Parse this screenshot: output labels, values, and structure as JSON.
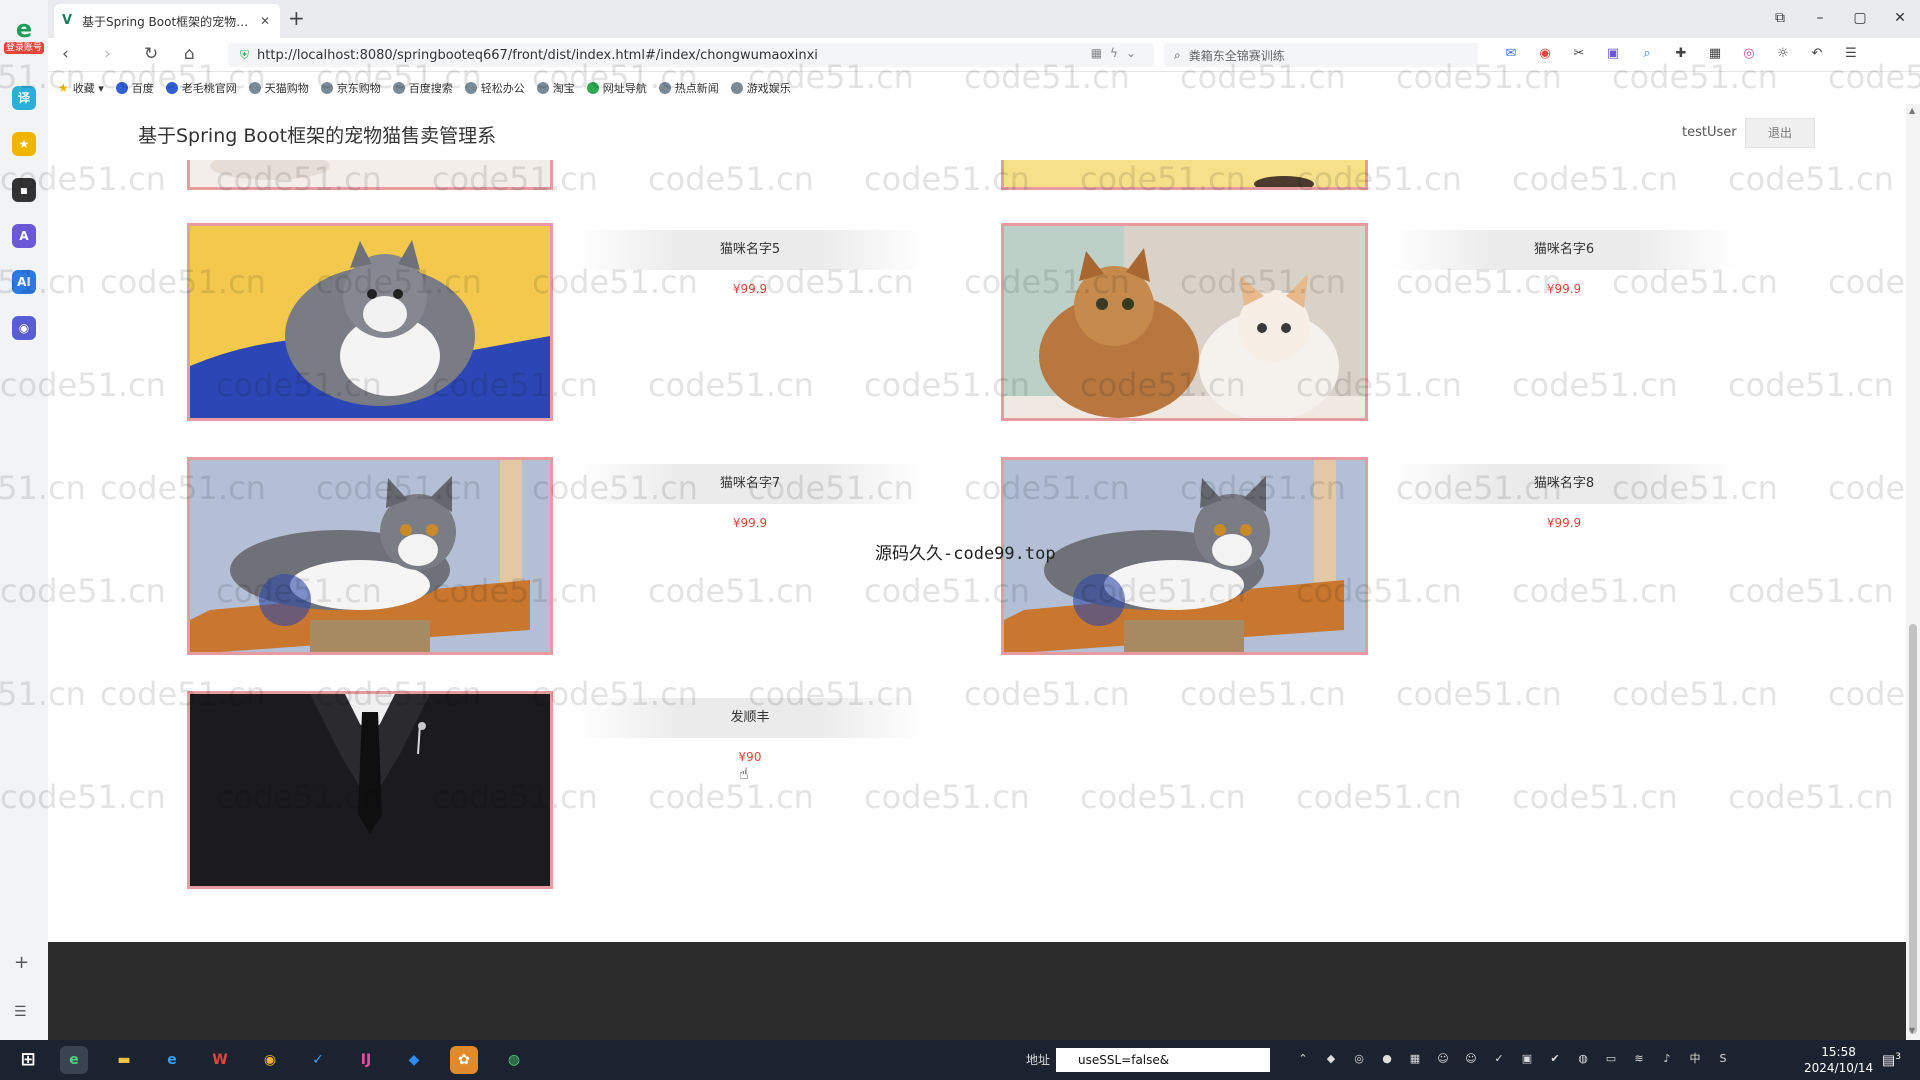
{
  "browser": {
    "tab_title": "基于Spring Boot框架的宠物猫售卖管理系",
    "tab_favicon": "V",
    "new_tab_icon": "plus-icon",
    "url": "http://localhost:8080/springbooteq667/front/dist/index.html#/index/chongwumaoxinxi",
    "search_placeholder": "粪箱东全锦赛训练",
    "sidebar_badge": "登录账号",
    "bookmarks": [
      "收藏",
      "百度",
      "老毛桃官网",
      "天猫购物",
      "京东购物",
      "百度搜索",
      "轻松办公",
      "淘宝",
      "网址导航",
      "热点新闻",
      "游戏娱乐"
    ]
  },
  "app": {
    "site_title": "基于Spring Boot框架的宠物猫售卖管理系",
    "username": "testUser",
    "logout_label": "退出",
    "watermark_text": "code51.cn",
    "center_note": "源码久久-code99.top",
    "products": [
      {
        "name": "猫咪名字5",
        "price": "¥99.9",
        "image": "grey-white-kitten-yellow-background"
      },
      {
        "name": "猫咪名字6",
        "price": "¥99.9",
        "image": "two-longhair-cats"
      },
      {
        "name": "猫咪名字7",
        "price": "¥99.9",
        "image": "british-shorthair-on-shelf"
      },
      {
        "name": "猫咪名字8",
        "price": "¥99.9",
        "image": "british-shorthair-on-shelf"
      },
      {
        "name": "发顺丰",
        "price": "¥90",
        "image": "black-suit"
      }
    ]
  },
  "taskbar": {
    "address_label": "地址",
    "address_value": "useSSL=false&",
    "time": "15:58",
    "date": "2024/10/14",
    "ime": "中",
    "notification_count": "3"
  },
  "colors": {
    "image_border": "#e79a9f",
    "price": "#e2453c",
    "footer": "#2c2c2c"
  }
}
